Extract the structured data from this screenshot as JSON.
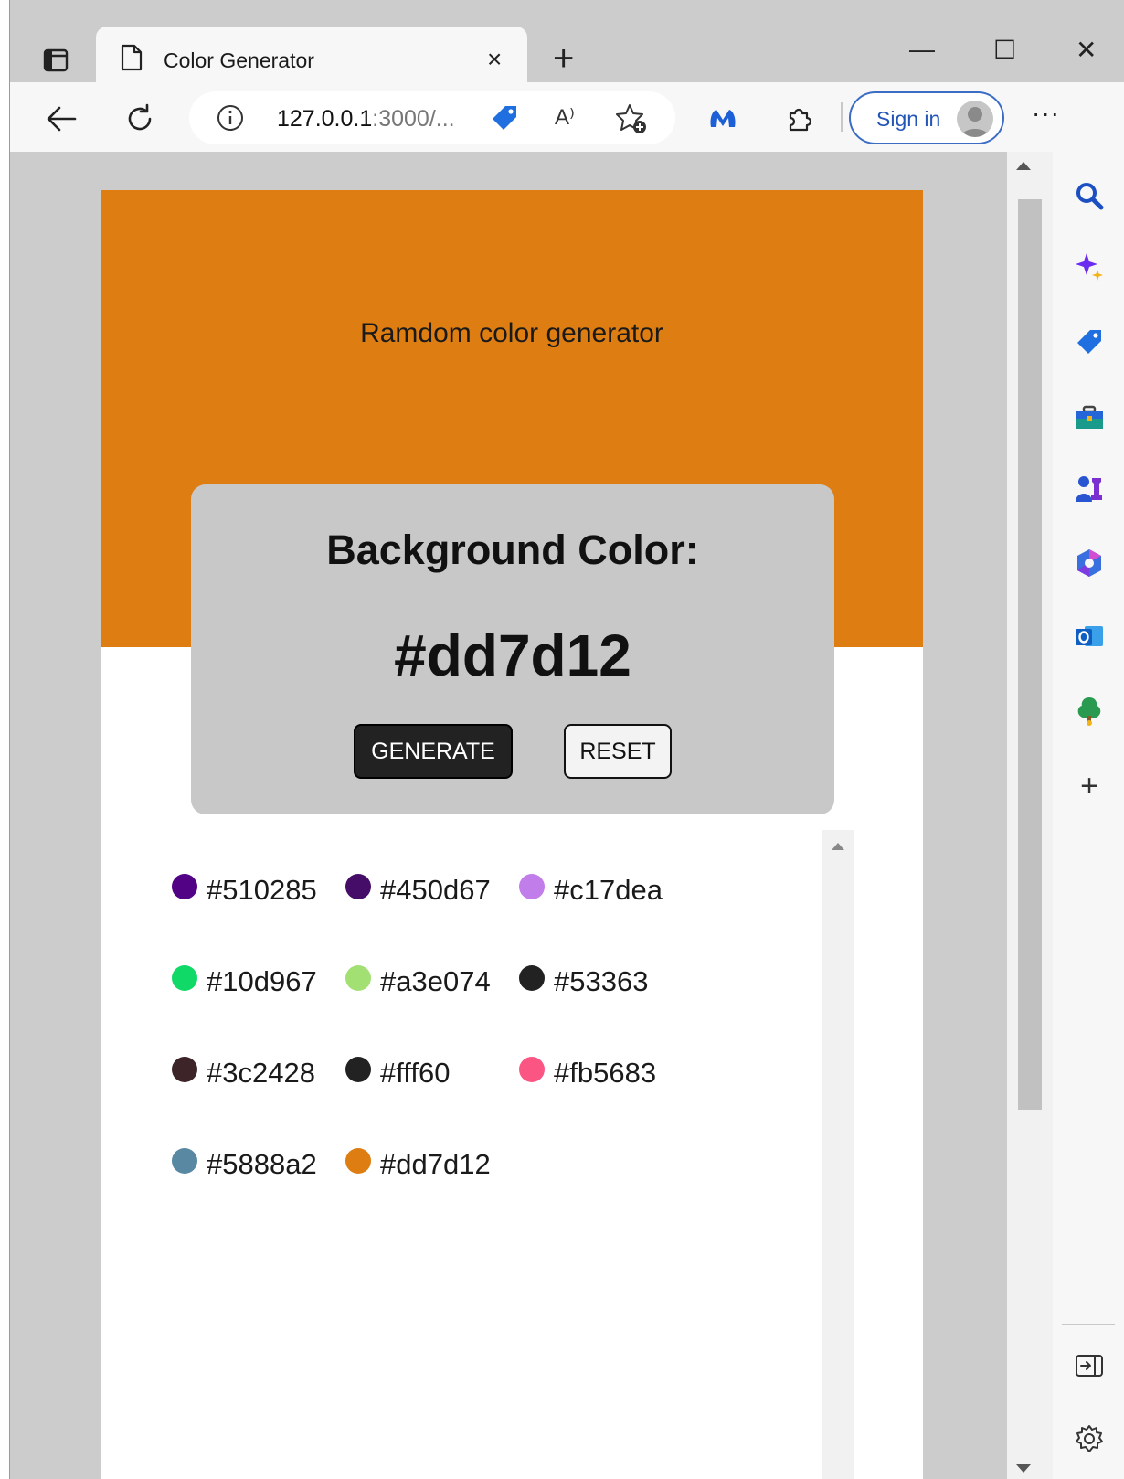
{
  "browser": {
    "tab_title": "Color Generator",
    "tab_close": "×",
    "new_tab": "+",
    "window_min": "—",
    "window_max": "☐",
    "window_close": "✕",
    "address": {
      "host": "127.0.0.1",
      "path": ":3000/..."
    },
    "read_aloud": "A⁾",
    "sign_in": "Sign in",
    "more": "···",
    "sidebar_add": "+"
  },
  "page": {
    "hero_title": "Ramdom color generator",
    "card_label": "Background Color:",
    "current_color": "#dd7d12",
    "generate_label": "GENERATE",
    "reset_label": "RESET",
    "history": [
      {
        "hex": "#510285",
        "color": "#510285"
      },
      {
        "hex": "#450d67",
        "color": "#450d67"
      },
      {
        "hex": "#c17dea",
        "color": "#c17dea"
      },
      {
        "hex": "#10d967",
        "color": "#10d967"
      },
      {
        "hex": "#a3e074",
        "color": "#a3e074"
      },
      {
        "hex": "#53363",
        "color": "#222222"
      },
      {
        "hex": "#3c2428",
        "color": "#3c2428"
      },
      {
        "hex": "#fff60",
        "color": "#222222"
      },
      {
        "hex": "#fb5683",
        "color": "#fb5683"
      },
      {
        "hex": "#5888a2",
        "color": "#5888a2"
      },
      {
        "hex": "#dd7d12",
        "color": "#dd7d12"
      }
    ]
  },
  "colors": {
    "hero_bg": "#dd7d12",
    "card_bg": "#c8c8c8",
    "generate_bg": "#222222",
    "signin_accent": "#2456b8"
  }
}
